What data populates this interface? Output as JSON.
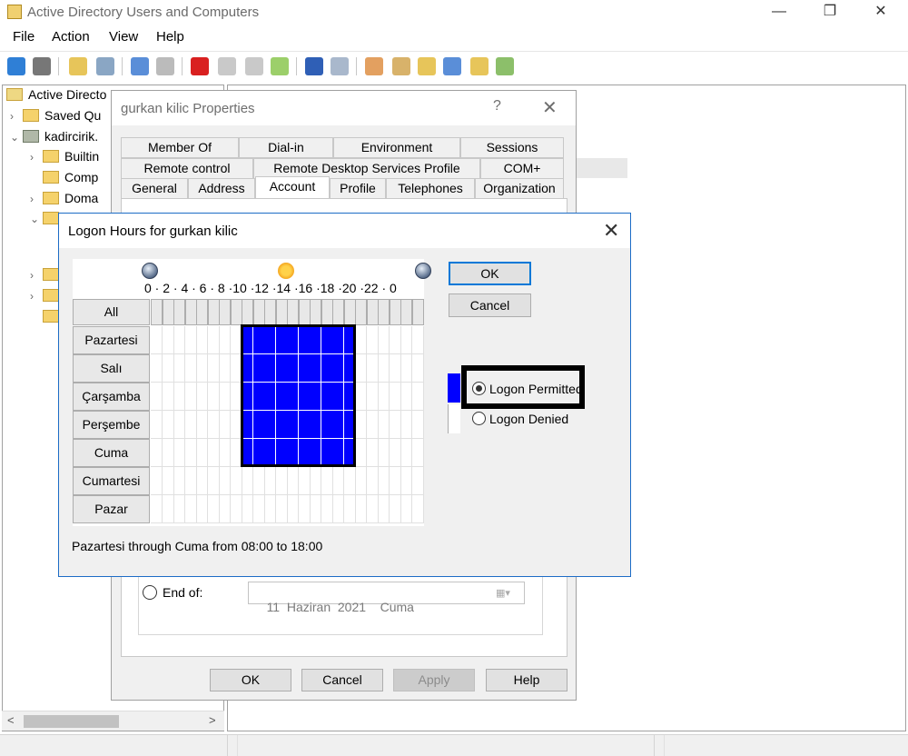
{
  "app": {
    "title": "Active Directory Users and Computers",
    "controls": {
      "minimize": "—",
      "restore": "❐",
      "close": "✕"
    }
  },
  "menu": [
    "File",
    "Action",
    "View",
    "Help"
  ],
  "tree": {
    "items": [
      {
        "chevron": "",
        "label": "Active Directo"
      },
      {
        "chevron": "›",
        "label": "Saved Qu"
      },
      {
        "chevron": "⌄",
        "label": "kadircirik."
      },
      {
        "chevron": "›",
        "label": "Builtin"
      },
      {
        "chevron": "",
        "label": "Comp"
      },
      {
        "chevron": "›",
        "label": "Doma"
      },
      {
        "chevron": "⌄",
        "label": ""
      },
      {
        "chevron": "›",
        "label": ""
      },
      {
        "chevron": "›",
        "label": ""
      },
      {
        "chevron": "",
        "label": ""
      }
    ],
    "scroll_left": "<",
    "scroll_right": ">"
  },
  "properties": {
    "title": "gurkan kilic Properties",
    "help": "?",
    "close": "✕",
    "tabs_row1": [
      "Member Of",
      "Dial-in",
      "Environment",
      "Sessions"
    ],
    "tabs_row2": [
      "Remote control",
      "Remote Desktop Services Profile",
      "COM+"
    ],
    "tabs_row3": [
      "General",
      "Address",
      "Account",
      "Profile",
      "Telephones",
      "Organization"
    ],
    "active_tab": "Account",
    "end_of_label": "End of:",
    "end_of_date": "11  Haziran  2021    Cuma",
    "date_picker_icon": "calendar-dropdown-icon",
    "buttons": {
      "ok": "OK",
      "cancel": "Cancel",
      "apply": "Apply",
      "help": "Help"
    }
  },
  "logon_hours": {
    "title": "Logon Hours for gurkan kilic",
    "close": "✕",
    "hour_ticks": "0 · 2 · 4 · 6 · 8 ·10 ·12 ·14 ·16 ·18 ·20 ·22 · 0",
    "all_label": "All",
    "days": [
      "Pazartesi",
      "Salı",
      "Çarşamba",
      "Perşembe",
      "Cuma",
      "Cumartesi",
      "Pazar"
    ],
    "permitted_days": [
      0,
      1,
      2,
      3,
      4
    ],
    "permitted_start_hour": 8,
    "permitted_end_hour": 18,
    "ok": "OK",
    "cancel": "Cancel",
    "logon_permitted": "Logon Permitted",
    "logon_denied": "Logon Denied",
    "selected_option": "Logon Permitted",
    "permit_color": "#0000ff",
    "summary": "Pazartesi through Cuma from 08:00 to 18:00"
  }
}
